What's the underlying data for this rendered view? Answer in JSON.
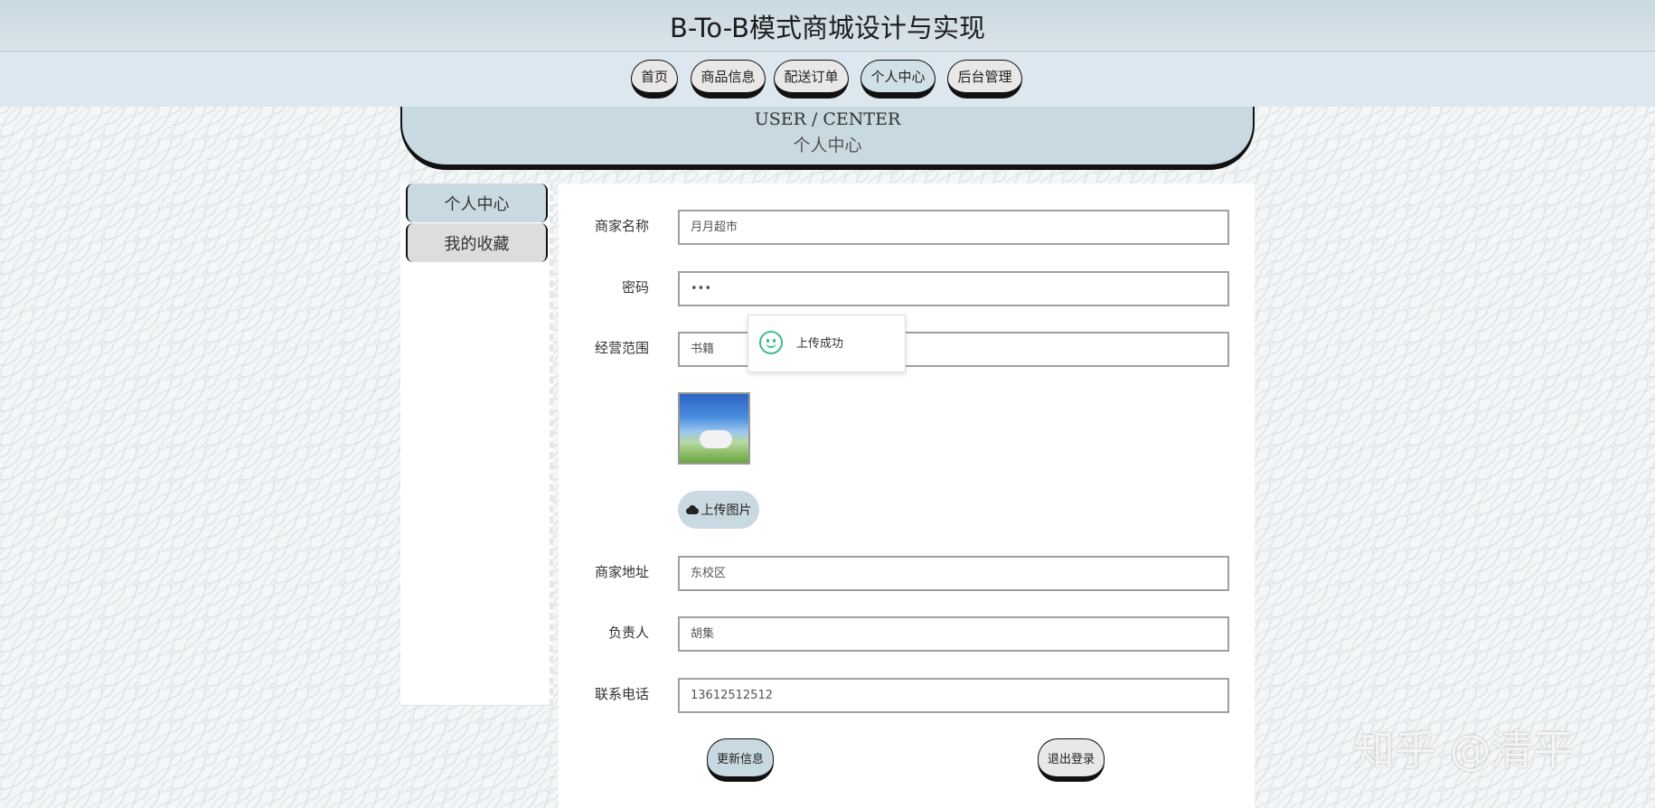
{
  "header": {
    "title": "B-To-B模式商城设计与实现"
  },
  "nav": {
    "items": [
      {
        "label": "首页"
      },
      {
        "label": "商品信息"
      },
      {
        "label": "配送订单"
      },
      {
        "label": "个人中心"
      },
      {
        "label": "后台管理"
      }
    ],
    "active": "个人中心"
  },
  "banner": {
    "english": "USER / CENTER",
    "chinese": "个人中心"
  },
  "sidebar": {
    "items": [
      {
        "label": "个人中心"
      },
      {
        "label": "我的收藏"
      }
    ]
  },
  "form": {
    "merchant_name": {
      "label": "商家名称",
      "value": "月月超市"
    },
    "password": {
      "label": "密码",
      "value": "•••"
    },
    "business_scope": {
      "label": "经营范围",
      "value": "书籍"
    },
    "upload_button": "上传图片",
    "address": {
      "label": "商家地址",
      "value": "东校区"
    },
    "manager": {
      "label": "负责人",
      "value": "胡集"
    },
    "phone": {
      "label": "联系电话",
      "value": "13612512512"
    },
    "update_button": "更新信息",
    "logout_button": "退出登录"
  },
  "toast": {
    "message": "上传成功"
  },
  "watermark": "知乎 @清平"
}
